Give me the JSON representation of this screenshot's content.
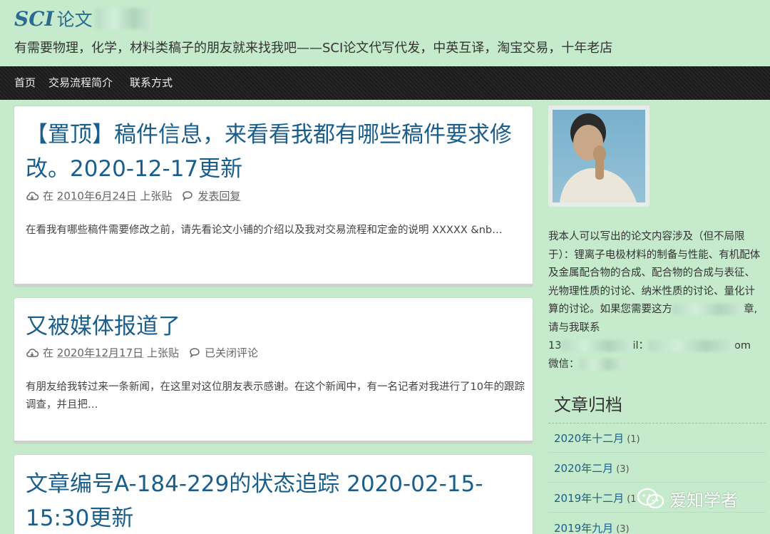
{
  "site": {
    "title_latin": "SCI",
    "title_cn": "论文",
    "description": "有需要物理，化学，材料类稿子的朋友就来找我吧——SCI论文代写代发，中英互译，淘宝交易，十年老店"
  },
  "nav": [
    {
      "label": "首页"
    },
    {
      "label": "交易流程简介"
    },
    {
      "label": "联系方式"
    }
  ],
  "posts": [
    {
      "title": "【置顶】稿件信息，来看看我都有哪些稿件要求修改。2020-12-17更新",
      "meta_prefix": "在",
      "date": "2010年6月24日",
      "author": "上张贴",
      "comment": "发表回复",
      "excerpt": "在看我有哪些稿件需要修改之前，请先看论文小铺的介绍以及我对交易流程和定金的说明 XXXXX &nb…"
    },
    {
      "title": "又被媒体报道了",
      "meta_prefix": "在",
      "date": "2020年12月17日",
      "author": "上张贴",
      "comment": "已关闭评论",
      "excerpt": "有朋友给我转过来一条新闻，在这里对这位朋友表示感谢。在这个新闻中，有一名记者对我进行了10年的跟踪调查，并且把…"
    },
    {
      "title": "文章编号A-184-229的状态追踪 2020-02-15-15:30更新"
    }
  ],
  "sidebar": {
    "bio_line1": "我本人可以写出的论文内容涉及（但不局限于）：锂离子电极材料的制备与性能、有机配体及金属配合物的合成、配合物的合成与表征、光物理性质的讨论、纳米性质的讨论、量化计算的讨论。如果您需要这方",
    "bio_line2": "章,请与我联系",
    "bio_line3_prefix": "13",
    "bio_line3_mid": "il：",
    "bio_line3_suffix": "om",
    "bio_line4": "微信：",
    "archive_title": "文章归档",
    "archives": [
      {
        "label": "2020年十二月",
        "count": "(1)"
      },
      {
        "label": "2020年二月",
        "count": "(3)"
      },
      {
        "label": "2019年十二月",
        "count": "(1"
      },
      {
        "label": "2019年九月",
        "count": "(3)"
      }
    ]
  },
  "watermark": {
    "text": "爱知学者"
  }
}
